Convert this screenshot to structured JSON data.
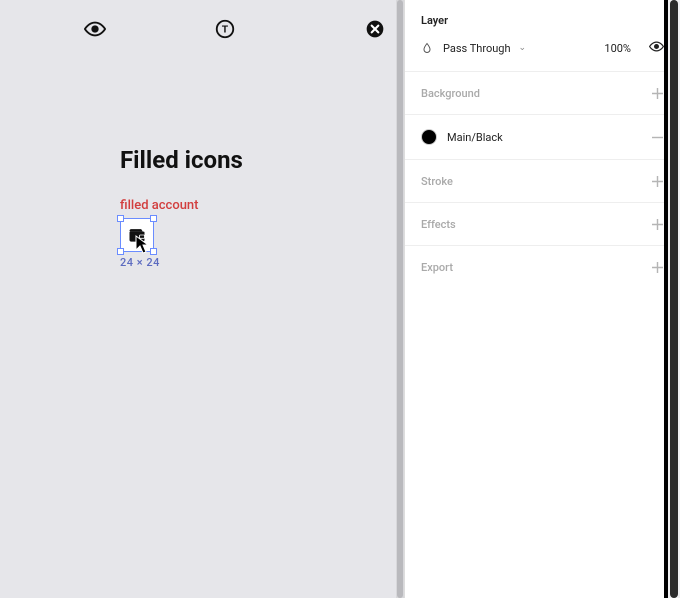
{
  "canvas": {
    "icons": {
      "watch": {
        "label": "watch"
      },
      "token": {
        "label": "token"
      },
      "close": {
        "label": "close-cir"
      }
    },
    "section_title": "Filled icons",
    "selection": {
      "label": "filled account",
      "dimensions": "24 × 24"
    }
  },
  "inspector": {
    "layer": {
      "title": "Layer",
      "blend_mode": "Pass Through",
      "opacity": "100%"
    },
    "background": {
      "title": "Background"
    },
    "fill": {
      "title": "Main/Black"
    },
    "stroke": {
      "title": "Stroke"
    },
    "effects": {
      "title": "Effects"
    },
    "export": {
      "title": "Export"
    }
  }
}
